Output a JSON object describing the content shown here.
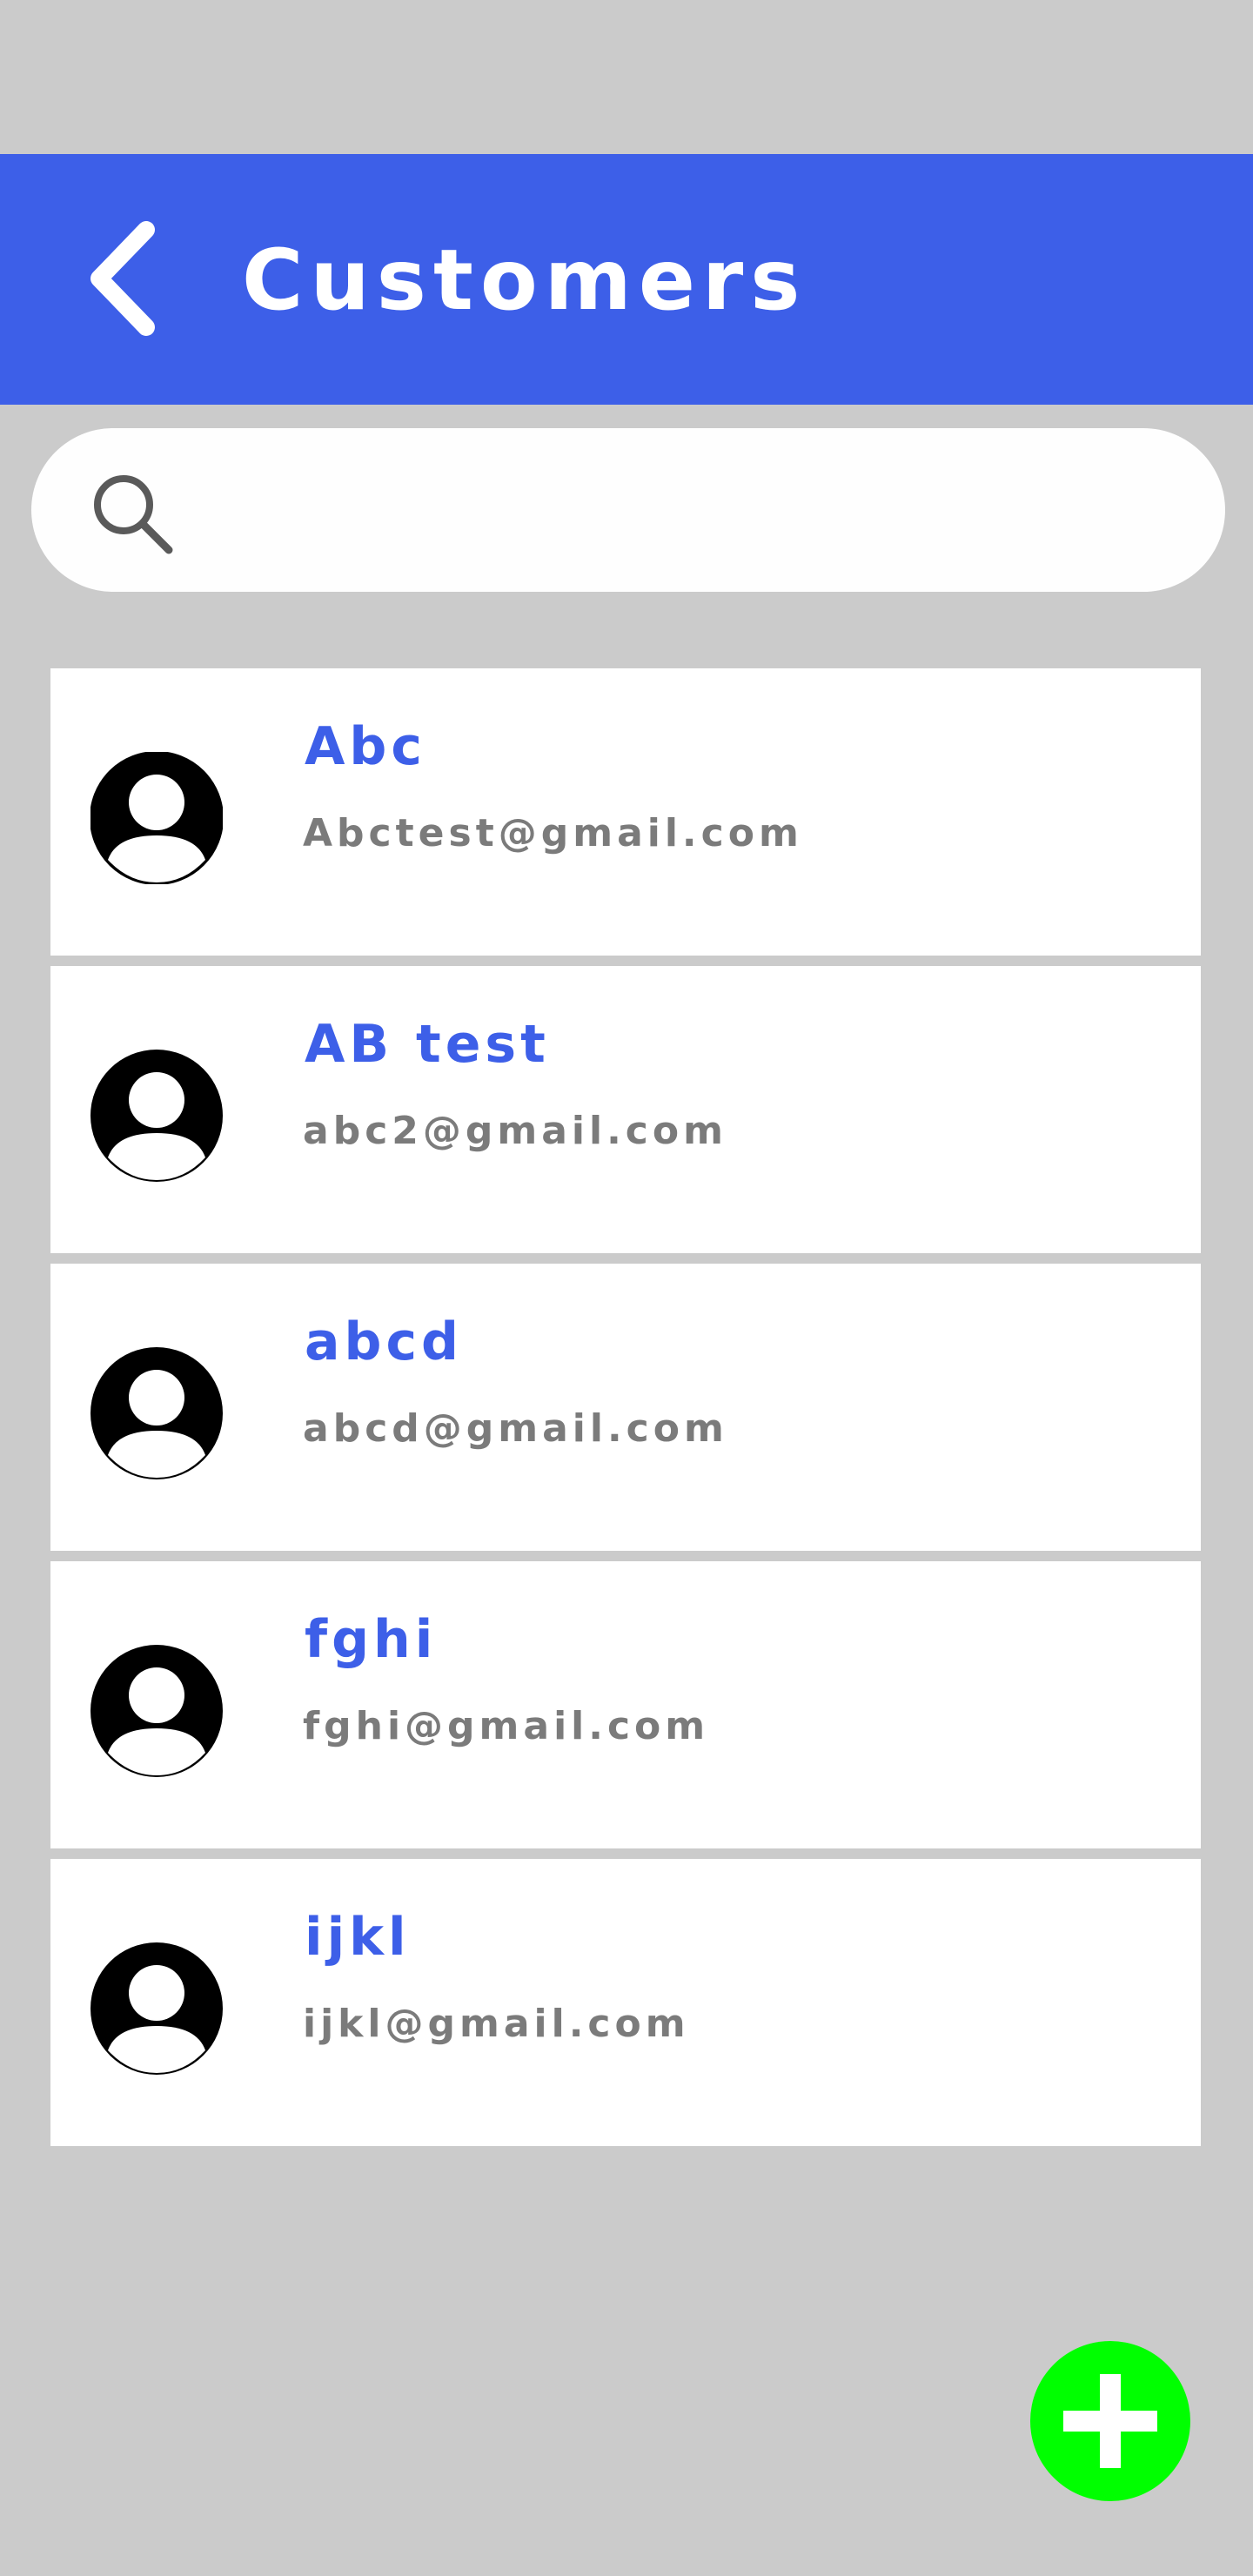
{
  "header": {
    "title": "Customers",
    "back_icon": "chevron-left-icon",
    "background_color": "#3d5fe8"
  },
  "search": {
    "icon": "search-icon",
    "placeholder": ""
  },
  "customers": [
    {
      "name": "Abc",
      "email": "Abctest@gmail.com",
      "icon": "avatar-icon"
    },
    {
      "name": "AB test",
      "email": "abc2@gmail.com",
      "icon": "avatar-icon"
    },
    {
      "name": "abcd",
      "email": "abcd@gmail.com",
      "icon": "avatar-icon"
    },
    {
      "name": "fghi",
      "email": "fghi@gmail.com",
      "icon": "avatar-icon"
    },
    {
      "name": "ijkl",
      "email": "ijkl@gmail.com",
      "icon": "avatar-icon"
    }
  ],
  "fab": {
    "icon": "plus-icon",
    "color": "#00ff00"
  },
  "colors": {
    "accent": "#3d5fe8",
    "email_text": "#7b7b7b",
    "background": "#cbcbcb"
  }
}
